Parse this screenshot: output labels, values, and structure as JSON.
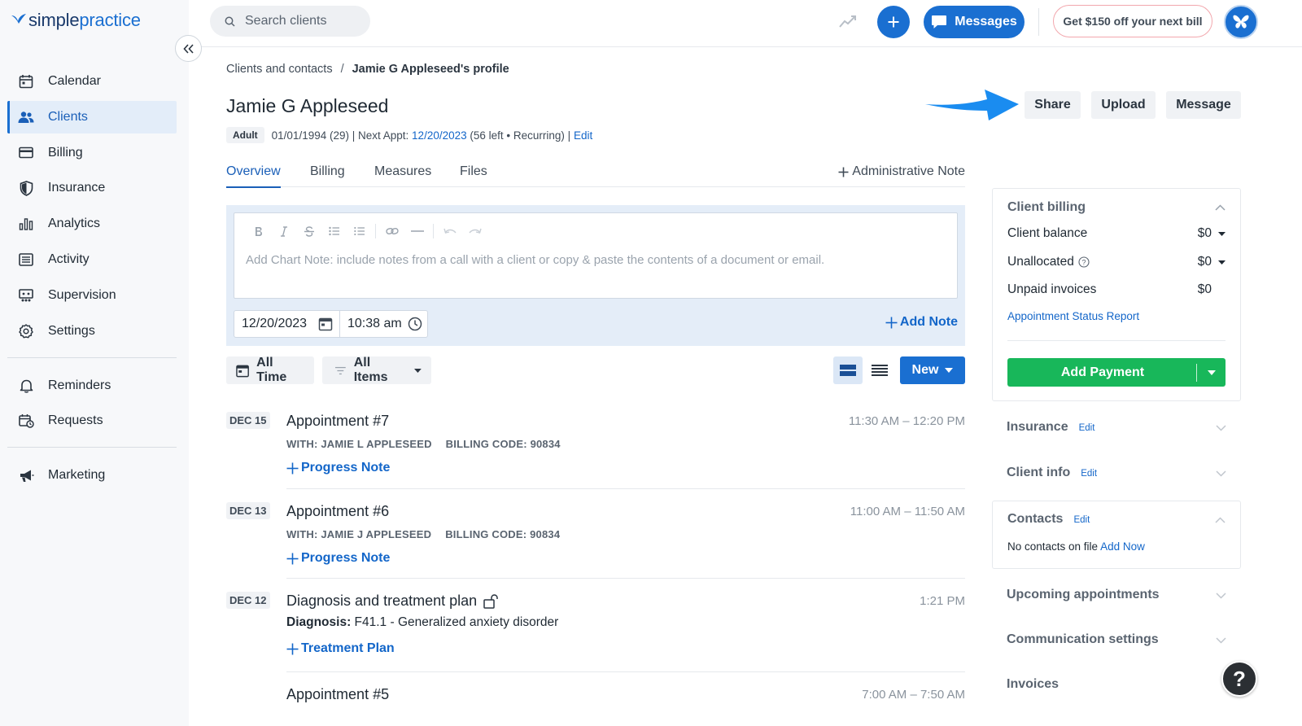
{
  "app": {
    "logo_simple": "simple",
    "logo_practice": "practice",
    "brand_color": "#1a6fd1"
  },
  "sidebar": {
    "items": [
      {
        "label": "Calendar",
        "icon": "calendar-icon"
      },
      {
        "label": "Clients",
        "icon": "users-icon",
        "active": true
      },
      {
        "label": "Billing",
        "icon": "credit-card-icon"
      },
      {
        "label": "Insurance",
        "icon": "shield-icon"
      },
      {
        "label": "Analytics",
        "icon": "bar-chart-icon"
      },
      {
        "label": "Activity",
        "icon": "list-icon"
      },
      {
        "label": "Supervision",
        "icon": "supervision-icon"
      },
      {
        "label": "Settings",
        "icon": "gear-icon"
      }
    ],
    "secondary": [
      {
        "label": "Reminders",
        "icon": "bell-icon"
      },
      {
        "label": "Requests",
        "icon": "calendar-request-icon"
      }
    ],
    "tertiary": [
      {
        "label": "Marketing",
        "icon": "megaphone-icon"
      }
    ]
  },
  "topbar": {
    "search_placeholder": "Search clients",
    "messages_label": "Messages",
    "promo_label": "Get $150 off your next bill"
  },
  "breadcrumb": {
    "parent": "Clients and contacts",
    "separator": "/",
    "current": "Jamie G Appleseed's profile"
  },
  "client": {
    "name": "Jamie G Appleseed",
    "badge": "Adult",
    "dob_age": "01/01/1994 (29) | Next Appt:",
    "next_appt": "12/20/2023",
    "appt_info": "(56 left • Recurring) |",
    "edit_label": "Edit"
  },
  "actions": {
    "share": "Share",
    "upload": "Upload",
    "message": "Message"
  },
  "tabs": [
    {
      "label": "Overview",
      "active": true
    },
    {
      "label": "Billing"
    },
    {
      "label": "Measures"
    },
    {
      "label": "Files"
    }
  ],
  "admin_note_label": "Administrative Note",
  "note": {
    "placeholder": "Add Chart Note: include notes from a call with a client or copy & paste the contents of a document or email.",
    "date": "12/20/2023",
    "time": "10:38 am",
    "add_note_label": "Add Note"
  },
  "filters": {
    "time_label": "All Time",
    "items_label": "All Items",
    "new_label": "New"
  },
  "timeline": [
    {
      "date": "DEC 15",
      "title": "Appointment #7",
      "time": "11:30 AM – 12:20 PM",
      "with": "WITH: JAMIE L APPLESEED",
      "billing": "BILLING CODE: 90834",
      "link": "Progress Note"
    },
    {
      "date": "DEC 13",
      "title": "Appointment #6",
      "time": "11:00 AM – 11:50 AM",
      "with": "WITH: JAMIE J APPLESEED",
      "billing": "BILLING CODE: 90834",
      "link": "Progress Note"
    },
    {
      "date": "DEC 12",
      "title": "Diagnosis and treatment plan",
      "time": "1:21 PM",
      "diagnosis_label": "Diagnosis:",
      "diagnosis": "F41.1 - Generalized anxiety disorder",
      "link": "Treatment Plan"
    },
    {
      "title": "Appointment #5",
      "time": "7:00 AM – 7:50 AM"
    }
  ],
  "client_billing": {
    "title": "Client billing",
    "rows": [
      {
        "label": "Client balance",
        "value": "$0"
      },
      {
        "label": "Unallocated",
        "value": "$0"
      },
      {
        "label": "Unpaid invoices",
        "value": "$0"
      }
    ],
    "report_link": "Appointment Status Report",
    "add_payment": "Add Payment",
    "payment_color": "#18b75a"
  },
  "sections": {
    "insurance": "Insurance",
    "client_info": "Client info",
    "contacts": "Contacts",
    "edit": "Edit",
    "no_contacts": "No contacts on file",
    "add_now": "Add Now",
    "upcoming": "Upcoming appointments",
    "communication": "Communication settings",
    "invoices": "Invoices"
  },
  "help_label": "?"
}
